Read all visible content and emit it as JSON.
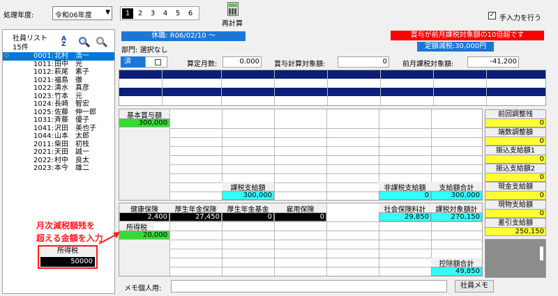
{
  "toolbar": {
    "year_label": "処理年度:",
    "year_value": "令和06年度",
    "pages": [
      "1",
      "2",
      "3",
      "4",
      "5",
      "6"
    ],
    "active_page": "1",
    "recalc_label": "再計算",
    "manual_label": "手入力を行う"
  },
  "sidebar": {
    "title": "社員リスト",
    "count": "15件",
    "employees": [
      {
        "code": "0001:",
        "name": "北村　浩一",
        "selected": true
      },
      {
        "code": "1011:",
        "name": "田中　光"
      },
      {
        "code": "1012:",
        "name": "萩尾　素子"
      },
      {
        "code": "1021:",
        "name": "福島　徹"
      },
      {
        "code": "1022:",
        "name": "清水　真彦"
      },
      {
        "code": "1023:",
        "name": "竹本　元"
      },
      {
        "code": "1024:",
        "name": "長崎　智宏"
      },
      {
        "code": "1025:",
        "name": "佐藤　伸一郎"
      },
      {
        "code": "1031:",
        "name": "斉藤　優子"
      },
      {
        "code": "1041:",
        "name": "沢田　美也子"
      },
      {
        "code": "1044:",
        "name": "山本　太郎"
      },
      {
        "code": "2011:",
        "name": "柴田　初枝"
      },
      {
        "code": "2021:",
        "name": "天田　誠一"
      },
      {
        "code": "2022:",
        "name": "村中　良太"
      },
      {
        "code": "2023:",
        "name": "本今　雄二"
      }
    ]
  },
  "header": {
    "leave_banner": "休職:  R06/02/10 〜",
    "department": "部門:  選択なし",
    "warning": "賞与が前月課税対象額の10倍超です",
    "fixed_tax": "定額減税:30,000円",
    "done_label": "済",
    "calc_months_label": "算定月数:",
    "calc_months_value": "0.000",
    "bonus_target_label": "賞与計算対象額:",
    "bonus_target_value": "0",
    "prev_taxable_label": "前月課税対象額:",
    "prev_taxable_value": "-41,200"
  },
  "pay": {
    "base_bonus_label": "基本賞与額",
    "base_bonus_value": "300,000",
    "taxable_label": "課税支給額",
    "taxable_value": "300,000",
    "nontaxable_label": "非課税支給額",
    "nontaxable_value": "0",
    "total_pay_label": "支給額合計",
    "total_pay_value": "300,000"
  },
  "deduct": {
    "health_label": "健康保険",
    "health_value": "2,400",
    "pension_label": "厚生年金保険",
    "pension_value": "27,450",
    "pension_fund_label": "厚生年金基金",
    "pension_fund_value": "0",
    "employment_label": "雇用保険",
    "employment_value": "0",
    "social_total_label": "社会保険料計",
    "social_total_value": "29,850",
    "taxable_total_label": "課税対象額計",
    "taxable_total_value": "270,150",
    "income_tax_label": "所得税",
    "income_tax_value": "20,000",
    "deduct_total_label": "控除額合計",
    "deduct_total_value": "49,850"
  },
  "right": {
    "prev_adjust_label": "前回調整残",
    "prev_adjust_value": "0",
    "fraction_label": "端数調整額",
    "fraction_value": "0",
    "transfer1_label": "振込支給額1",
    "transfer1_value": "0",
    "transfer2_label": "振込支給額2",
    "transfer2_value": "0",
    "cash_label": "現金支給額",
    "cash_value": "0",
    "goods_label": "現物支給額",
    "goods_value": "0",
    "net_label": "差引支給額",
    "net_value": "250,150"
  },
  "annotation": {
    "line1": "月次減税額残を",
    "line2": "超える金額を入力",
    "tax_box_label": "所得税",
    "tax_box_value": "50000"
  },
  "memo": {
    "label": "メモ個人用:",
    "button": "社員メモ"
  }
}
